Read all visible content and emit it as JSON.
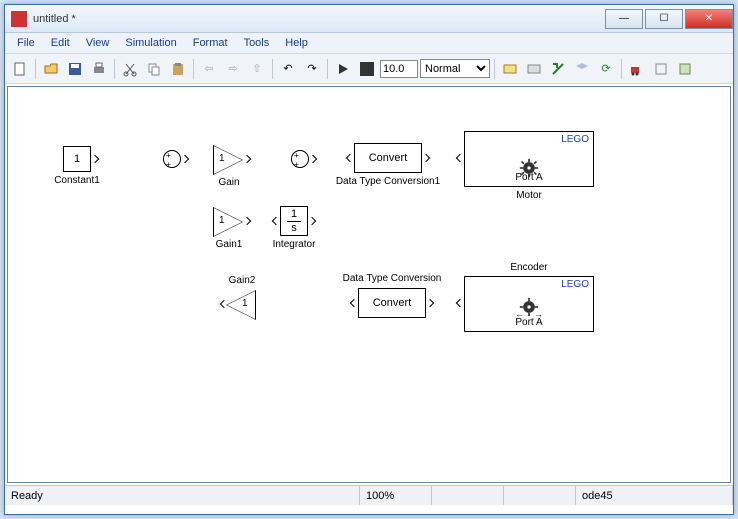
{
  "window": {
    "title": "untitled *"
  },
  "menu": {
    "file": "File",
    "edit": "Edit",
    "view": "View",
    "simulation": "Simulation",
    "format": "Format",
    "tools": "Tools",
    "help": "Help"
  },
  "toolbar": {
    "sim_time": "10.0",
    "sim_mode": "Normal"
  },
  "blocks": {
    "constant1": {
      "value": "1",
      "label": "Constant1"
    },
    "sum1": {
      "label": ""
    },
    "gain": {
      "value": "1",
      "label": "Gain"
    },
    "sum2": {
      "label": ""
    },
    "dtc1": {
      "text": "Convert",
      "label": "Data Type Conversion1"
    },
    "motor": {
      "brand": "LEGO",
      "port": "Port A",
      "label": "Motor"
    },
    "gain1": {
      "value": "1",
      "label": "Gain1"
    },
    "integrator": {
      "num": "1",
      "den": "s",
      "label": "Integrator"
    },
    "gain2": {
      "value": "1",
      "label": "Gain2"
    },
    "dtc": {
      "text": "Convert",
      "label": "Data Type Conversion"
    },
    "encoder": {
      "brand": "LEGO",
      "port": "Port A",
      "label": "Encoder"
    }
  },
  "status": {
    "ready": "Ready",
    "zoom": "100%",
    "solver": "ode45"
  }
}
